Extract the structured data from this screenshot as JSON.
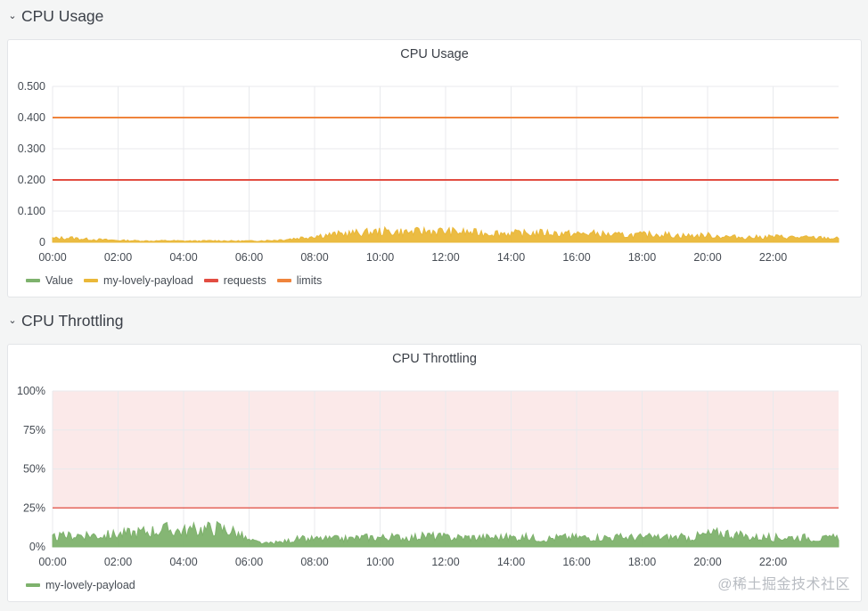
{
  "rows": [
    {
      "title": "CPU Usage",
      "icon": "chevron-down-icon"
    },
    {
      "title": "CPU Throttling",
      "icon": "chevron-down-icon"
    }
  ],
  "watermark": "@稀土掘金技术社区",
  "colors": {
    "value": "#7eb26d",
    "payload": "#eab839",
    "requests": "#e24d42",
    "limits": "#ef843c",
    "throttle": "#7eb26d",
    "threshold_line": "#e24d42",
    "threshold_fill": "#fbe9e9"
  },
  "chart_data": [
    {
      "type": "area",
      "title": "CPU Usage",
      "xlabel": "",
      "ylabel": "",
      "x_ticks": [
        "00:00",
        "02:00",
        "04:00",
        "06:00",
        "08:00",
        "10:00",
        "12:00",
        "14:00",
        "16:00",
        "18:00",
        "20:00",
        "22:00"
      ],
      "y_ticks": [
        "0",
        "0.100",
        "0.200",
        "0.300",
        "0.400",
        "0.500"
      ],
      "ylim": [
        0,
        0.5
      ],
      "xlim_hours": [
        0,
        24
      ],
      "grid": true,
      "legend": "bottom-left",
      "legend_entries": [
        "Value",
        "my-lovely-payload",
        "requests",
        "limits"
      ],
      "series": [
        {
          "name": "limits",
          "style": "line",
          "constant": 0.4
        },
        {
          "name": "requests",
          "style": "line",
          "constant": 0.2
        },
        {
          "name": "my-lovely-payload",
          "style": "area",
          "hours": [
            0,
            0.5,
            1,
            1.5,
            2,
            2.5,
            3,
            3.5,
            4,
            4.5,
            5,
            5.5,
            6,
            6.5,
            7,
            7.5,
            8,
            8.5,
            9,
            9.5,
            10,
            10.5,
            11,
            11.5,
            12,
            12.5,
            13,
            13.5,
            14,
            14.5,
            15,
            15.5,
            16,
            16.5,
            17,
            17.5,
            18,
            18.5,
            19,
            19.5,
            20,
            20.5,
            21,
            21.5,
            22,
            22.5,
            23,
            23.5,
            24
          ],
          "values": [
            0.012,
            0.014,
            0.01,
            0.008,
            0.006,
            0.005,
            0.004,
            0.005,
            0.004,
            0.004,
            0.005,
            0.004,
            0.004,
            0.005,
            0.008,
            0.013,
            0.02,
            0.024,
            0.028,
            0.03,
            0.034,
            0.033,
            0.032,
            0.036,
            0.034,
            0.032,
            0.03,
            0.03,
            0.028,
            0.028,
            0.03,
            0.028,
            0.026,
            0.028,
            0.024,
            0.022,
            0.024,
            0.026,
            0.022,
            0.02,
            0.022,
            0.018,
            0.016,
            0.016,
            0.018,
            0.016,
            0.015,
            0.014,
            0.012
          ]
        },
        {
          "name": "Value",
          "style": "line",
          "values": []
        }
      ]
    },
    {
      "type": "area",
      "title": "CPU Throttling",
      "xlabel": "",
      "ylabel": "",
      "x_ticks": [
        "00:00",
        "02:00",
        "04:00",
        "06:00",
        "08:00",
        "10:00",
        "12:00",
        "14:00",
        "16:00",
        "18:00",
        "20:00",
        "22:00"
      ],
      "y_ticks": [
        "0%",
        "25%",
        "50%",
        "75%",
        "100%"
      ],
      "ylim": [
        0,
        100
      ],
      "xlim_hours": [
        0,
        24
      ],
      "grid": true,
      "legend": "bottom-left",
      "legend_entries": [
        "my-lovely-payload"
      ],
      "threshold": 25,
      "series": [
        {
          "name": "my-lovely-payload",
          "style": "area",
          "hours": [
            0,
            0.5,
            1,
            1.5,
            2,
            2.5,
            3,
            3.5,
            4,
            4.5,
            5,
            5.5,
            6,
            6.5,
            7,
            7.5,
            8,
            8.5,
            9,
            9.5,
            10,
            10.5,
            11,
            11.5,
            12,
            12.5,
            13,
            13.5,
            14,
            14.5,
            15,
            15.5,
            16,
            16.5,
            17,
            17.5,
            18,
            18.5,
            19,
            19.5,
            20,
            20.5,
            21,
            21.5,
            22,
            22.5,
            23,
            23.5,
            24
          ],
          "values": [
            6,
            7,
            8,
            7,
            8,
            9,
            10,
            11,
            10,
            11,
            12,
            10,
            4,
            2,
            3,
            5,
            5,
            5,
            5,
            6,
            6,
            6,
            6,
            7,
            6,
            6,
            6,
            6,
            6,
            6,
            5,
            6,
            6,
            6,
            6,
            6,
            6,
            6,
            6,
            6,
            8,
            9,
            7,
            6,
            6,
            6,
            6,
            5,
            6
          ]
        }
      ]
    }
  ]
}
